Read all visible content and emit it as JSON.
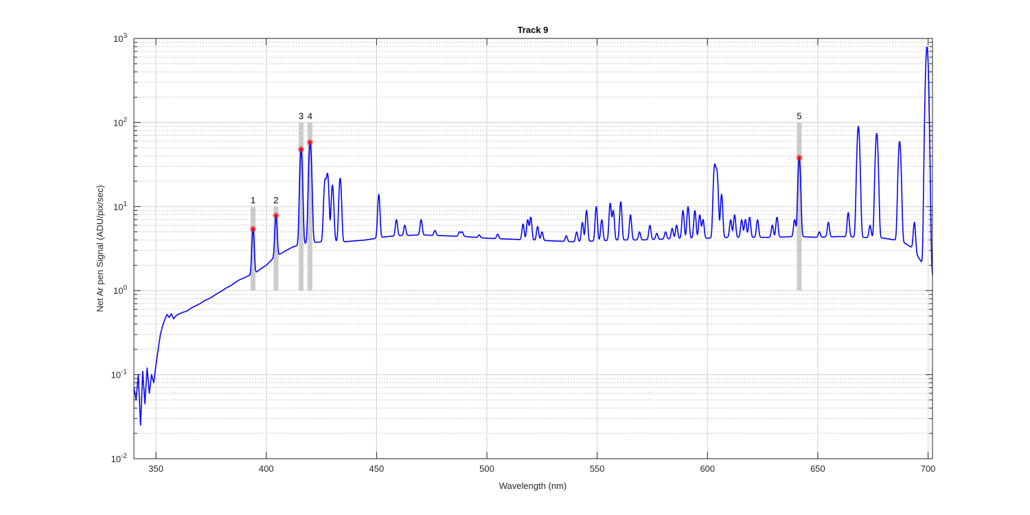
{
  "chart_data": {
    "type": "line",
    "title": "Track 9",
    "xlabel": "Wavelength (nm)",
    "ylabel": "Net Ar pen Signal (ADU/pix/sec)",
    "xlim": [
      340,
      702
    ],
    "ylim": [
      0.01,
      1000
    ],
    "yscale": "log",
    "grid": true,
    "x_ticks": [
      350,
      400,
      450,
      500,
      550,
      600,
      650,
      700
    ],
    "x_tick_labels": [
      "350",
      "400",
      "450",
      "500",
      "550",
      "600",
      "650",
      "700"
    ],
    "y_ticks": [
      0.01,
      0.1,
      1,
      10,
      100,
      1000
    ],
    "y_tick_labels": [
      {
        "base": "10",
        "exp": "-2"
      },
      {
        "base": "10",
        "exp": "-1"
      },
      {
        "base": "10",
        "exp": "0"
      },
      {
        "base": "10",
        "exp": "1"
      },
      {
        "base": "10",
        "exp": "2"
      },
      {
        "base": "10",
        "exp": "3"
      }
    ],
    "line_color": "#0000ff",
    "band_color": "#cccccc",
    "marker_color": "#ff0000",
    "baseline": [
      [
        340,
        0.07
      ],
      [
        341,
        0.05
      ],
      [
        342,
        0.1
      ],
      [
        343,
        0.025
      ],
      [
        344,
        0.11
      ],
      [
        345,
        0.045
      ],
      [
        346,
        0.12
      ],
      [
        347,
        0.06
      ],
      [
        348,
        0.1
      ],
      [
        349,
        0.08
      ],
      [
        350,
        0.13
      ],
      [
        351,
        0.2
      ],
      [
        352,
        0.3
      ],
      [
        353,
        0.38
      ],
      [
        354,
        0.45
      ],
      [
        355,
        0.52
      ],
      [
        356,
        0.48
      ],
      [
        357,
        0.53
      ],
      [
        358,
        0.46
      ],
      [
        359,
        0.5
      ],
      [
        360,
        0.52
      ],
      [
        362,
        0.55
      ],
      [
        364,
        0.57
      ],
      [
        366,
        0.62
      ],
      [
        368,
        0.66
      ],
      [
        370,
        0.7
      ],
      [
        372,
        0.76
      ],
      [
        374,
        0.8
      ],
      [
        376,
        0.86
      ],
      [
        378,
        0.93
      ],
      [
        380,
        1.0
      ],
      [
        382,
        1.08
      ],
      [
        384,
        1.15
      ],
      [
        386,
        1.25
      ],
      [
        388,
        1.35
      ],
      [
        390,
        1.42
      ],
      [
        392,
        1.5
      ],
      [
        395,
        1.62
      ],
      [
        398,
        1.85
      ],
      [
        400,
        2.0
      ],
      [
        403,
        2.4
      ],
      [
        406,
        2.7
      ],
      [
        409,
        3.0
      ],
      [
        412,
        3.3
      ],
      [
        415,
        3.5
      ],
      [
        420,
        3.7
      ],
      [
        425,
        3.8
      ],
      [
        430,
        3.9
      ],
      [
        435,
        3.8
      ],
      [
        440,
        3.9
      ],
      [
        445,
        4.0
      ],
      [
        450,
        4.2
      ],
      [
        455,
        4.4
      ],
      [
        460,
        4.5
      ],
      [
        470,
        4.6
      ],
      [
        480,
        4.5
      ],
      [
        490,
        4.4
      ],
      [
        500,
        4.2
      ],
      [
        510,
        4.1
      ],
      [
        520,
        4.0
      ],
      [
        530,
        3.9
      ],
      [
        540,
        3.8
      ],
      [
        550,
        3.9
      ],
      [
        560,
        4.0
      ],
      [
        570,
        4.0
      ],
      [
        580,
        4.1
      ],
      [
        590,
        4.2
      ],
      [
        600,
        4.2
      ],
      [
        610,
        4.3
      ],
      [
        620,
        4.3
      ],
      [
        630,
        4.3
      ],
      [
        640,
        4.4
      ],
      [
        650,
        4.3
      ],
      [
        660,
        4.4
      ],
      [
        670,
        4.3
      ],
      [
        680,
        4.2
      ],
      [
        685,
        4.0
      ],
      [
        688,
        3.8
      ],
      [
        690,
        3.6
      ],
      [
        693,
        3.2
      ],
      [
        696,
        2.4
      ],
      [
        698,
        2.0
      ],
      [
        699,
        3.0
      ],
      [
        700,
        5.0
      ],
      [
        701,
        2.5
      ],
      [
        702,
        1.5
      ]
    ],
    "peaks": [
      [
        394.0,
        5.4
      ],
      [
        404.4,
        7.8
      ],
      [
        415.8,
        48
      ],
      [
        419.9,
        58
      ],
      [
        426.6,
        20
      ],
      [
        427.8,
        24
      ],
      [
        430.0,
        18
      ],
      [
        433.5,
        22
      ],
      [
        451.0,
        14
      ],
      [
        459.0,
        7
      ],
      [
        462.8,
        6
      ],
      [
        470.2,
        7
      ],
      [
        476.5,
        5.2
      ],
      [
        487.6,
        5.0
      ],
      [
        488.8,
        5.0
      ],
      [
        496.5,
        4.6
      ],
      [
        504.9,
        4.7
      ],
      [
        516.4,
        6.2
      ],
      [
        518.5,
        7.0
      ],
      [
        519.9,
        7.5
      ],
      [
        523.0,
        5.8
      ],
      [
        525.0,
        5.0
      ],
      [
        536.0,
        4.5
      ],
      [
        540.7,
        5.0
      ],
      [
        543.3,
        6.5
      ],
      [
        545.2,
        9.0
      ],
      [
        549.6,
        10.0
      ],
      [
        552.1,
        7.0
      ],
      [
        555.9,
        11.0
      ],
      [
        557.3,
        9.0
      ],
      [
        560.7,
        11.5
      ],
      [
        565.1,
        8.0
      ],
      [
        569.2,
        5.0
      ],
      [
        573.9,
        6.0
      ],
      [
        577.0,
        4.8
      ],
      [
        581.0,
        5.0
      ],
      [
        584.0,
        5.5
      ],
      [
        586.0,
        6.0
      ],
      [
        588.9,
        9.0
      ],
      [
        591.2,
        10.0
      ],
      [
        594.3,
        9.0
      ],
      [
        596.5,
        8.0
      ],
      [
        598.0,
        7.0
      ],
      [
        603.2,
        30.0
      ],
      [
        604.3,
        25.0
      ],
      [
        606.4,
        14.0
      ],
      [
        610.5,
        7.0
      ],
      [
        612.3,
        8.0
      ],
      [
        615.5,
        7.0
      ],
      [
        617.2,
        7.0
      ],
      [
        619.1,
        7.5
      ],
      [
        622.7,
        7.0
      ],
      [
        629.4,
        6.0
      ],
      [
        631.5,
        7.5
      ],
      [
        639.5,
        7.0
      ],
      [
        641.6,
        38.0
      ],
      [
        650.7,
        5.0
      ],
      [
        654.8,
        6.5
      ],
      [
        663.8,
        8.5
      ],
      [
        668.4,
        90.0
      ],
      [
        673.7,
        6.0
      ],
      [
        676.7,
        75.0
      ],
      [
        687.1,
        60.0
      ],
      [
        693.8,
        6.5
      ],
      [
        699.5,
        800.0
      ]
    ],
    "bands": [
      {
        "label": "1",
        "x": 394.0,
        "peak": 5.4
      },
      {
        "label": "2",
        "x": 404.4,
        "peak": 7.8
      },
      {
        "label": "3",
        "x": 415.8,
        "peak": 48
      },
      {
        "label": "4",
        "x": 419.8,
        "peak": 58
      },
      {
        "label": "5",
        "x": 641.6,
        "peak": 38
      }
    ]
  }
}
